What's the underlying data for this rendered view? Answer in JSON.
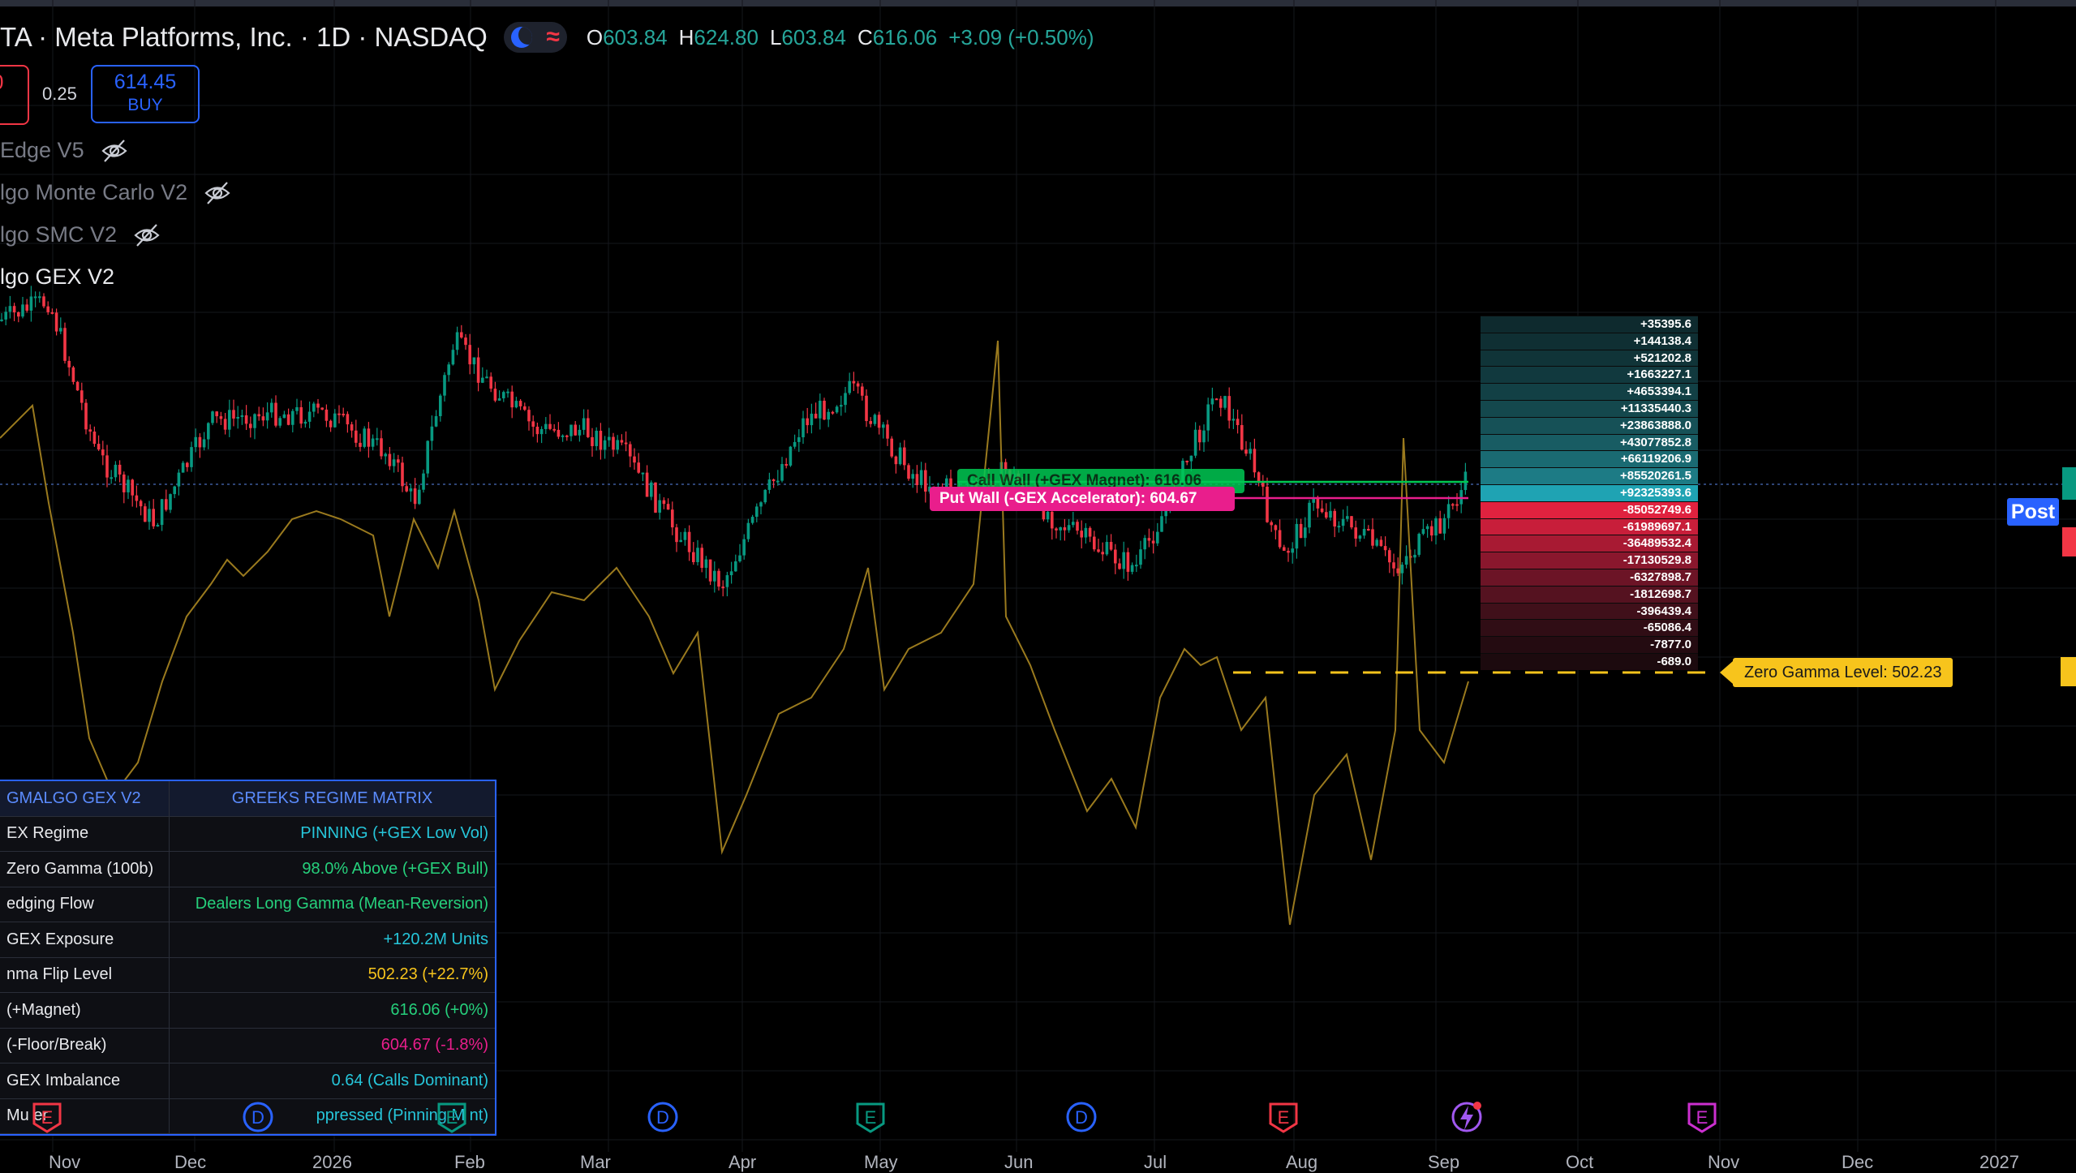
{
  "header": {
    "title": "TA · Meta Platforms, Inc. · 1D · NASDAQ",
    "ohlc": {
      "o_label": "O",
      "o_value": "603.84",
      "h_label": "H",
      "h_value": "624.80",
      "l_label": "L",
      "l_value": "603.84",
      "c_label": "C",
      "c_value": "616.06",
      "change": "+3.09 (+0.50%)"
    }
  },
  "trade": {
    "sell_price_fragment": "0",
    "spread": "0.25",
    "buy_price": "614.45",
    "buy_label": "BUY"
  },
  "indicators": [
    {
      "label": "Edge V5",
      "visible": false
    },
    {
      "label": "lgo Monte Carlo V2",
      "visible": false
    },
    {
      "label": "lgo SMC V2",
      "visible": false
    },
    {
      "label": "lgo GEX V2",
      "visible": true
    }
  ],
  "gex_levels": [
    "+35395.6",
    "+144138.4",
    "+521202.8",
    "+1663227.1",
    "+4653394.1",
    "+11335440.3",
    "+23863888.0",
    "+43077852.8",
    "+66119206.9",
    "+85520261.5",
    "+92325393.6",
    "-85052749.6",
    "-61989697.1",
    "-36489532.4",
    "-17130529.8",
    "-6327898.7",
    "-1812698.7",
    "-396439.4",
    "-65086.4",
    "-7877.0",
    "-689.0"
  ],
  "walls": {
    "call_wall": "Call Wall (+GEX Magnet): 616.06",
    "put_wall": "Put Wall (-GEX Accelerator): 604.67",
    "zero_gamma": "Zero Gamma Level: 502.23"
  },
  "price_tag": "Post",
  "matrix": {
    "header_left": "GMALGO GEX V2",
    "header_right": "GREEKS REGIME MATRIX",
    "rows": [
      {
        "label": "EX Regime",
        "value": "PINNING (+GEX Low Vol)",
        "color": "#26c6da"
      },
      {
        "label": "Zero Gamma (100b)",
        "value": "98.0% Above (+GEX Bull)",
        "color": "#26d07c"
      },
      {
        "label": "edging Flow",
        "value": "Dealers Long Gamma (Mean-Reversion)",
        "color": "#26d07c"
      },
      {
        "label": "GEX Exposure",
        "value": "+120.2M Units",
        "color": "#26c6da"
      },
      {
        "label": "nma Flip Level",
        "value": "502.23 (+22.7%)",
        "color": "#f7c41c"
      },
      {
        "label": "(+Magnet)",
        "value": "616.06 (+0%)",
        "color": "#26d07c"
      },
      {
        "label": "(-Floor/Break)",
        "value": "604.67 (-1.8%)",
        "color": "#e91e8c"
      },
      {
        "label": "GEX Imbalance",
        "value": "0.64 (Calls Dominant)",
        "color": "#26c6da"
      },
      {
        "label": "Mu     er",
        "value": "ppressed (Pinning M   nt)",
        "color": "#26c6da"
      }
    ]
  },
  "x_axis": [
    "Nov",
    "Dec",
    "2026",
    "Feb",
    "Mar",
    "Apr",
    "May",
    "Jun",
    "Jul",
    "Aug",
    "Sep",
    "Oct",
    "Nov",
    "Dec",
    "2027"
  ],
  "events": [
    {
      "type": "earnings",
      "letter": "E",
      "color": "#f23645"
    },
    {
      "type": "dividend",
      "letter": "D",
      "color": "#2962ff"
    },
    {
      "type": "earnings",
      "letter": "E",
      "color": "#089981"
    },
    {
      "type": "dividend",
      "letter": "D",
      "color": "#2962ff"
    },
    {
      "type": "earnings",
      "letter": "E",
      "color": "#089981"
    },
    {
      "type": "dividend",
      "letter": "D",
      "color": "#2962ff"
    },
    {
      "type": "earnings",
      "letter": "E",
      "color": "#f23645"
    },
    {
      "type": "news",
      "letter": "",
      "color": "#a158f0"
    },
    {
      "type": "earnings",
      "letter": "E",
      "color": "#cc2fd0"
    }
  ],
  "colors": {
    "up": "#089981",
    "down": "#f23645",
    "gamma_line": "#9a7a1e",
    "zero_gamma": "#f7c41c",
    "call_wall": "#00c853",
    "put_wall": "#e91e8c",
    "accent": "#2962ff"
  }
}
